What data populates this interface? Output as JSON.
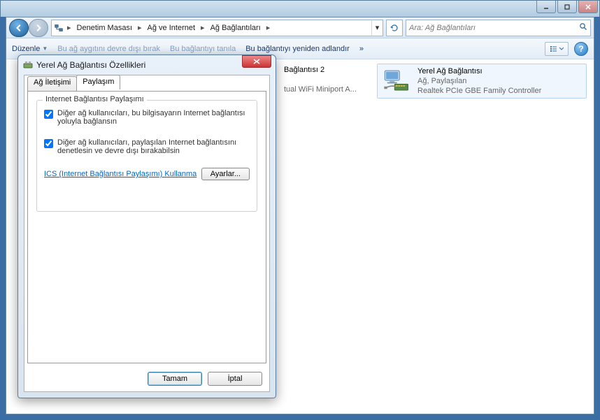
{
  "window": {
    "minimize": "—",
    "maximize": "□",
    "close": "X"
  },
  "breadcrumb": {
    "seg1": "Denetim Masası",
    "seg2": "Ağ ve Internet",
    "seg3": "Ağ Bağlantıları"
  },
  "search": {
    "placeholder": "Ara: Ağ Bağlantıları"
  },
  "toolbar": {
    "organize": "Düzenle",
    "disable": "Bu ağ aygıtını devre dışı bırak",
    "diagnose": "Bu bağlantıyı tanıla",
    "rename": "Bu bağlantıyı yeniden adlandır",
    "more": "»"
  },
  "connections": {
    "left": {
      "title": "Bağlantısı 2",
      "sub2": "tual WiFi Miniport A..."
    },
    "right": {
      "title": "Yerel Ağ Bağlantısı",
      "sub1": "Ağ, Paylaşılan",
      "sub2": "Realtek PCIe GBE Family Controller"
    }
  },
  "dialog": {
    "title": "Yerel Ağ Bağlantısı Özellikleri",
    "tab1": "Ağ İletişimi",
    "tab2": "Paylaşım",
    "group_title": "Internet Bağlantısı Paylaşımı",
    "check1": "Diğer ağ kullanıcıları, bu bilgisayarın Internet bağlantısı yoluyla bağlansın",
    "check2": "Diğer ağ kullanıcıları, paylaşılan Internet bağlantısını denetlesin ve devre dışı bırakabilsin",
    "ics_link": "ICS (Internet Bağlantısı Paylaşımı) Kullanma",
    "settings_btn": "Ayarlar...",
    "ok": "Tamam",
    "cancel": "İptal"
  }
}
